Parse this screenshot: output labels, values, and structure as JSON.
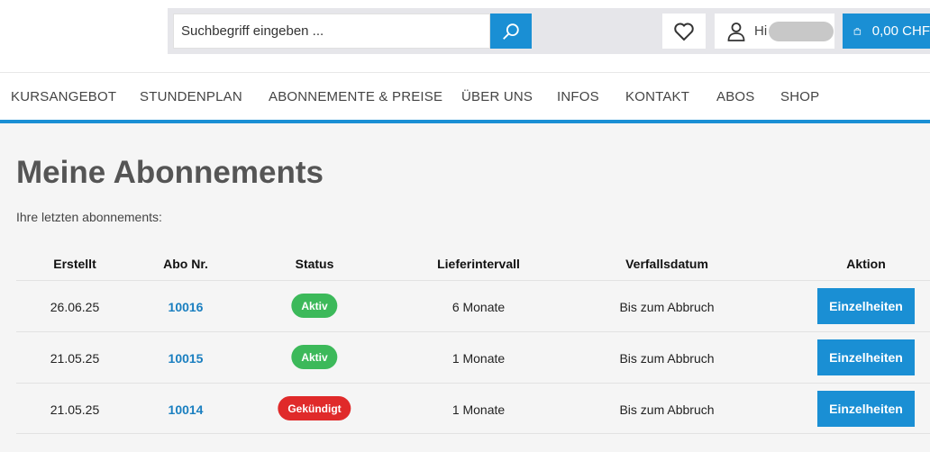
{
  "header": {
    "search": {
      "placeholder": "Suchbegriff eingeben ..."
    },
    "account": {
      "greeting": "Hi"
    },
    "cart": {
      "total": "0,00 CHF"
    }
  },
  "nav": {
    "items": [
      {
        "label": "KURSANGEBOT"
      },
      {
        "label": "STUNDENPLAN"
      },
      {
        "label": "ABONNEMENTE & PREISE"
      },
      {
        "label": "ÜBER UNS"
      },
      {
        "label": "INFOS"
      },
      {
        "label": "KONTAKT"
      },
      {
        "label": "ABOS"
      },
      {
        "label": "SHOP"
      }
    ]
  },
  "main": {
    "title": "Meine Abonnements",
    "subtitle": "Ihre letzten abonnements:",
    "table": {
      "columns": [
        "Erstellt",
        "Abo Nr.",
        "Status",
        "Lieferintervall",
        "Verfallsdatum",
        "Aktion"
      ],
      "rows": [
        {
          "created": "26.06.25",
          "abo_nr": "10016",
          "status": "Aktiv",
          "interval": "6 Monate",
          "expiry": "Bis zum Abbruch",
          "action": "Einzelheiten"
        },
        {
          "created": "21.05.25",
          "abo_nr": "10015",
          "status": "Aktiv",
          "interval": "1 Monate",
          "expiry": "Bis zum Abbruch",
          "action": "Einzelheiten"
        },
        {
          "created": "21.05.25",
          "abo_nr": "10014",
          "status": "Gekündigt",
          "interval": "1 Monate",
          "expiry": "Bis zum Abbruch",
          "action": "Einzelheiten"
        }
      ]
    }
  },
  "colors": {
    "accent": "#1a8fd4",
    "active": "#3cb95a",
    "cancelled": "#e02a2a",
    "link": "#1a7fc0"
  }
}
